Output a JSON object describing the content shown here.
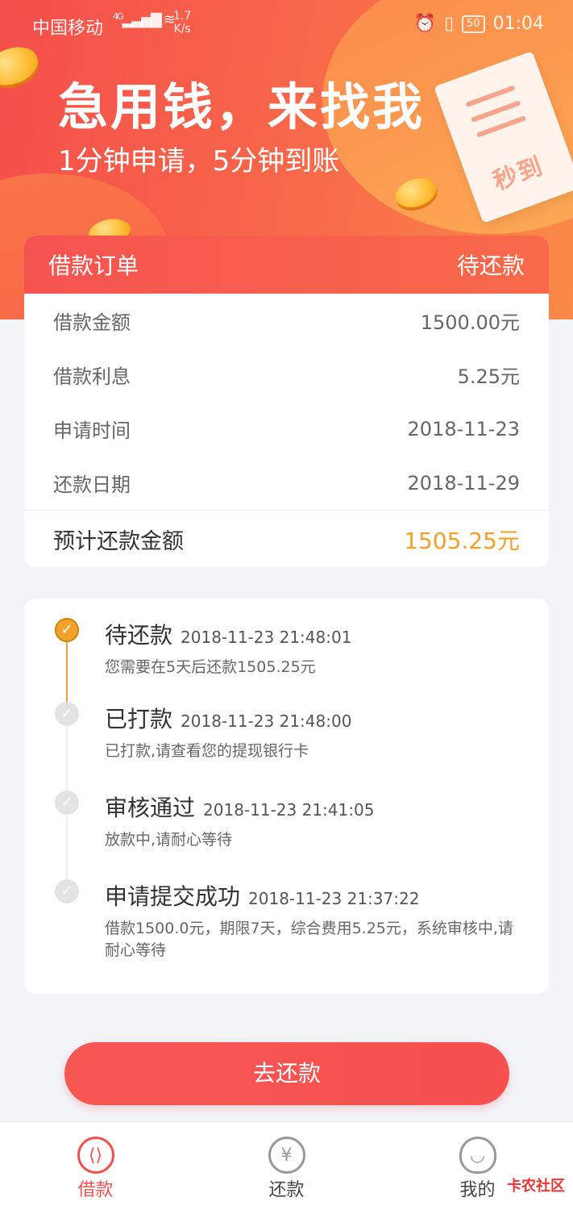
{
  "status_bar": {
    "carrier": "中国移动",
    "network": "4G",
    "speed_value": "1.7",
    "speed_unit": "K/s",
    "battery": "50",
    "time": "01:04"
  },
  "hero": {
    "title": "急用钱，来找我",
    "subtitle": "1分钟申请，5分钟到账",
    "receipt_stamp": "秒到"
  },
  "order": {
    "header_title": "借款订单",
    "status": "待还款",
    "rows": [
      {
        "label": "借款金额",
        "value": "1500.00元"
      },
      {
        "label": "借款利息",
        "value": "5.25元"
      },
      {
        "label": "申请时间",
        "value": "2018-11-23"
      },
      {
        "label": "还款日期",
        "value": "2018-11-29"
      }
    ],
    "total_label": "预计还款金额",
    "total_value": "1505.25元"
  },
  "timeline": [
    {
      "title": "待还款",
      "time": "2018-11-23 21:48:01",
      "desc": "您需要在5天后还款1505.25元"
    },
    {
      "title": "已打款",
      "time": "2018-11-23 21:48:00",
      "desc": "已打款,请查看您的提现银行卡"
    },
    {
      "title": "审核通过",
      "time": "2018-11-23 21:41:05",
      "desc": "放款中,请耐心等待"
    },
    {
      "title": "申请提交成功",
      "time": "2018-11-23 21:37:22",
      "desc": "借款1500.0元，期限7天，综合费用5.25元，系统审核中,请耐心等待"
    }
  ],
  "repay_button": "去还款",
  "tabs": [
    {
      "label": "借款",
      "icon": "loan-icon"
    },
    {
      "label": "还款",
      "icon": "repay-yen-icon"
    },
    {
      "label": "我的",
      "icon": "user-icon"
    }
  ],
  "watermark": "卡农社区",
  "colors": {
    "brand_red": "#f65350",
    "accent_orange": "#f2a026"
  }
}
